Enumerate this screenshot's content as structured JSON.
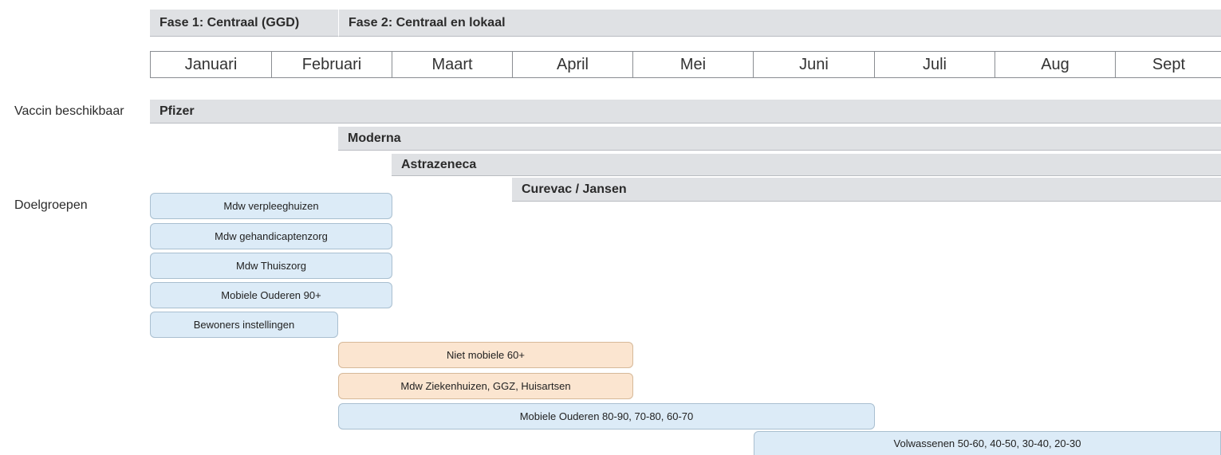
{
  "phases": [
    {
      "label": "Fase 1: Centraal (GGD)"
    },
    {
      "label": "Fase 2: Centraal en lokaal"
    }
  ],
  "months": [
    "Januari",
    "Februari",
    "Maart",
    "April",
    "Mei",
    "Juni",
    "Juli",
    "Aug",
    "Sept"
  ],
  "labels": {
    "vaccines": "Vaccin beschikbaar",
    "groups": "Doelgroepen"
  },
  "vaccines": [
    {
      "name": "Pfizer"
    },
    {
      "name": "Moderna"
    },
    {
      "name": "Astrazeneca"
    },
    {
      "name": "Curevac / Jansen"
    }
  ],
  "groups": [
    {
      "label": "Mdw verpleeghuizen",
      "color": "#dcebf7"
    },
    {
      "label": "Mdw gehandicaptenzorg",
      "color": "#dcebf7"
    },
    {
      "label": "Mdw Thuiszorg",
      "color": "#dcebf7"
    },
    {
      "label": "Mobiele Ouderen 90+",
      "color": "#dcebf7"
    },
    {
      "label": "Bewoners instellingen",
      "color": "#dcebf7"
    },
    {
      "label": "Niet mobiele 60+",
      "color": "#fbe5d0"
    },
    {
      "label": "Mdw Ziekenhuizen, GGZ, Huisartsen",
      "color": "#fbe5d0"
    },
    {
      "label": "Mobiele Ouderen 80-90, 70-80, 60-70",
      "color": "#dcebf7"
    },
    {
      "label": "Volwassenen 50-60, 40-50, 30-40, 20-30",
      "color": "#dcebf7"
    }
  ]
}
